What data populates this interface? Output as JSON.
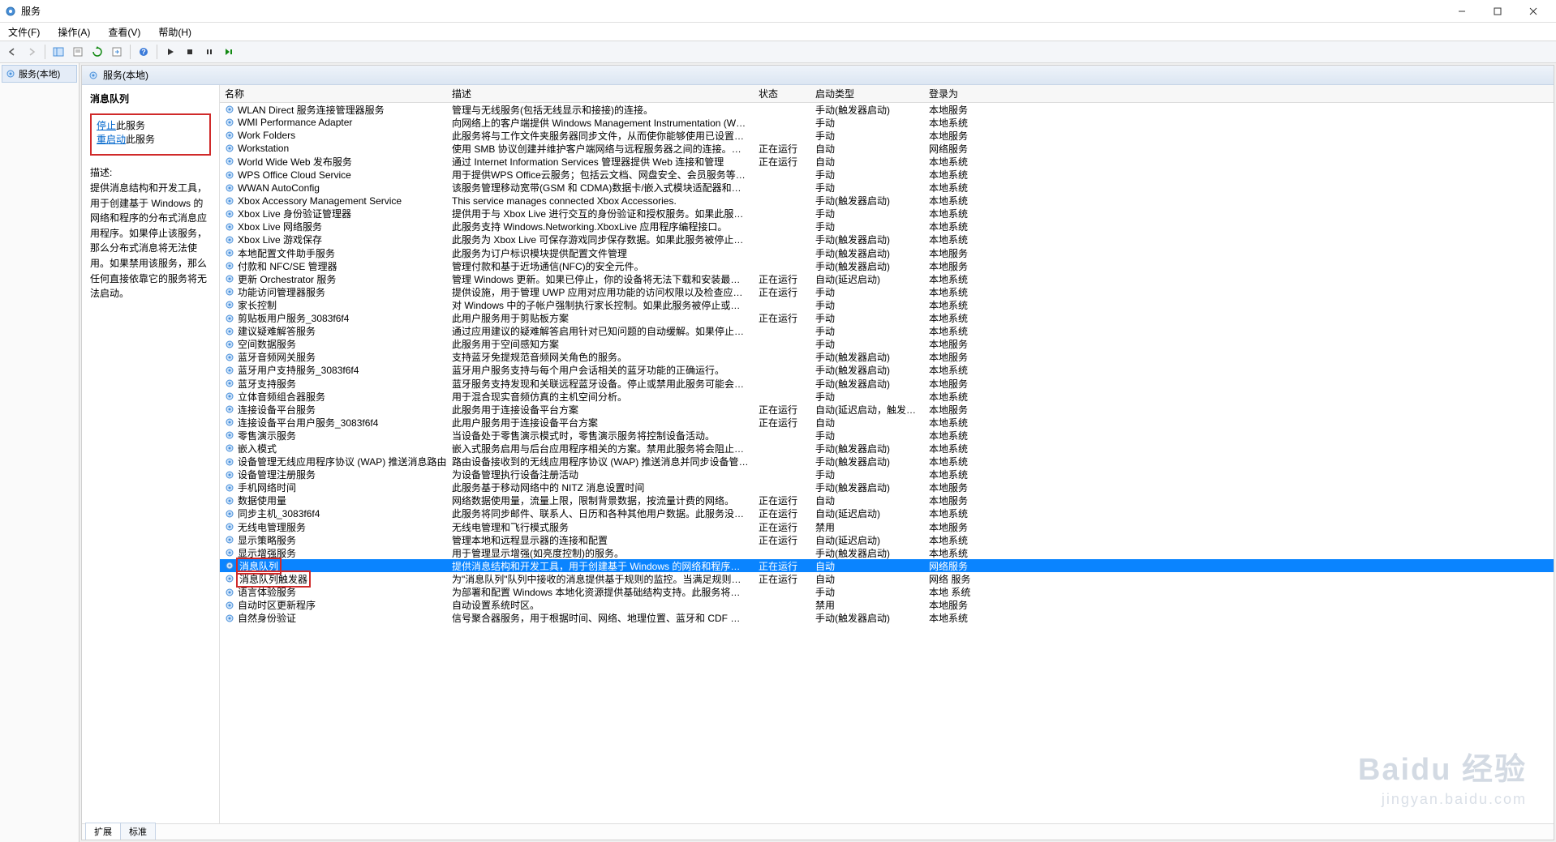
{
  "window": {
    "title": "服务"
  },
  "menu": {
    "file": "文件(F)",
    "action": "操作(A)",
    "view": "查看(V)",
    "help": "帮助(H)"
  },
  "tree": {
    "root": "服务(本地)"
  },
  "center_header": "服务(本地)",
  "detail": {
    "title": "消息队列",
    "stop_link": "停止",
    "stop_suffix": "此服务",
    "restart_link": "重启动",
    "restart_suffix": "此服务",
    "desc_label": "描述:",
    "desc_text": "提供消息结构和开发工具，用于创建基于 Windows 的网络和程序的分布式消息应用程序。如果停止该服务，那么分布式消息将无法使用。如果禁用该服务，那么任何直接依靠它的服务将无法启动。"
  },
  "columns": {
    "name": "名称",
    "desc": "描述",
    "status": "状态",
    "startup": "启动类型",
    "logon": "登录为"
  },
  "footer_tabs": {
    "extended": "扩展",
    "standard": "标准"
  },
  "watermark": {
    "brand": "Baidu 经验",
    "sub": "jingyan.baidu.com"
  },
  "services": [
    {
      "name": "WLAN Direct 服务连接管理器服务",
      "desc": "管理与无线服务(包括无线显示和接接)的连接。",
      "status": "",
      "startup": "手动(触发器启动)",
      "logon": "本地服务"
    },
    {
      "name": "WMI Performance Adapter",
      "desc": "向网络上的客户端提供 Windows Management Instrumentation (WMI) 提供程序中...",
      "status": "",
      "startup": "手动",
      "logon": "本地系统"
    },
    {
      "name": "Work Folders",
      "desc": "此服务将与工作文件夹服务器同步文件，从而使你能够使用已设置工作文件夹的任何电...",
      "status": "",
      "startup": "手动",
      "logon": "本地服务"
    },
    {
      "name": "Workstation",
      "desc": "使用 SMB 协议创建并维护客户端网络与远程服务器之间的连接。如果此服务已停止,...",
      "status": "正在运行",
      "startup": "自动",
      "logon": "网络服务"
    },
    {
      "name": "World Wide Web 发布服务",
      "desc": "通过 Internet Information Services 管理器提供 Web 连接和管理",
      "status": "正在运行",
      "startup": "自动",
      "logon": "本地系统"
    },
    {
      "name": "WPS Office Cloud Service",
      "desc": "用于提供WPS Office云服务；包括云文档、网盘安全、会员服务等多种云资源。为用户...",
      "status": "",
      "startup": "手动",
      "logon": "本地系统"
    },
    {
      "name": "WWAN AutoConfig",
      "desc": "该服务管理移动宽带(GSM 和 CDMA)数据卡/嵌入式模块适配器和自动配置网络的连接...",
      "status": "",
      "startup": "手动",
      "logon": "本地系统"
    },
    {
      "name": "Xbox Accessory Management Service",
      "desc": "This service manages connected Xbox Accessories.",
      "status": "",
      "startup": "手动(触发器启动)",
      "logon": "本地系统"
    },
    {
      "name": "Xbox Live 身份验证管理器",
      "desc": "提供用于与 Xbox Live 进行交互的身份验证和授权服务。如果此服务被停止，可能会造...",
      "status": "",
      "startup": "手动",
      "logon": "本地系统"
    },
    {
      "name": "Xbox Live 网络服务",
      "desc": "此服务支持 Windows.Networking.XboxLive 应用程序编程接口。",
      "status": "",
      "startup": "手动",
      "logon": "本地系统"
    },
    {
      "name": "Xbox Live 游戏保存",
      "desc": "此服务为 Xbox Live 可保存游戏同步保存数据。如果此服务被停止，游戏保存数据将不...",
      "status": "",
      "startup": "手动(触发器启动)",
      "logon": "本地系统"
    },
    {
      "name": "本地配置文件助手服务",
      "desc": "此服务为订户标识模块提供配置文件管理",
      "status": "",
      "startup": "手动(触发器启动)",
      "logon": "本地服务"
    },
    {
      "name": "付款和 NFC/SE 管理器",
      "desc": "管理付款和基于近场通信(NFC)的安全元件。",
      "status": "",
      "startup": "手动(触发器启动)",
      "logon": "本地服务"
    },
    {
      "name": "更新 Orchestrator 服务",
      "desc": "管理 Windows 更新。如果已停止，你的设备将无法下载和安装最新更新。",
      "status": "正在运行",
      "startup": "自动(延迟启动)",
      "logon": "本地系统"
    },
    {
      "name": "功能访问管理器服务",
      "desc": "提供设施，用于管理 UWP 应用对应用功能的访问权限以及检查应用的特定应用功能访...",
      "status": "正在运行",
      "startup": "手动",
      "logon": "本地系统"
    },
    {
      "name": "家长控制",
      "desc": "对 Windows 中的子帐户强制执行家长控制。如果此服务被停止或禁用，家长控制可能...",
      "status": "",
      "startup": "手动",
      "logon": "本地系统"
    },
    {
      "name": "剪贴板用户服务_3083f6f4",
      "desc": "此用户服务用于剪贴板方案",
      "status": "正在运行",
      "startup": "手动",
      "logon": "本地系统"
    },
    {
      "name": "建议疑难解答服务",
      "desc": "通过应用建议的疑难解答启用针对已知问题的自动缓解。如果停止，你的设备将不会获得...",
      "status": "",
      "startup": "手动",
      "logon": "本地系统"
    },
    {
      "name": "空间数据服务",
      "desc": "此服务用于空间感知方案",
      "status": "",
      "startup": "手动",
      "logon": "本地服务"
    },
    {
      "name": "蓝牙音频网关服务",
      "desc": "支持蓝牙免提规范音频网关角色的服务。",
      "status": "",
      "startup": "手动(触发器启动)",
      "logon": "本地服务"
    },
    {
      "name": "蓝牙用户支持服务_3083f6f4",
      "desc": "蓝牙用户服务支持与每个用户会话相关的蓝牙功能的正确运行。",
      "status": "",
      "startup": "手动(触发器启动)",
      "logon": "本地系统"
    },
    {
      "name": "蓝牙支持服务",
      "desc": "蓝牙服务支持发现和关联远程蓝牙设备。停止或禁用此服务可能会导致已安装的蓝牙设...",
      "status": "",
      "startup": "手动(触发器启动)",
      "logon": "本地服务"
    },
    {
      "name": "立体音频组合器服务",
      "desc": "用于混合现实音频仿真的主机空间分析。",
      "status": "",
      "startup": "手动",
      "logon": "本地系统"
    },
    {
      "name": "连接设备平台服务",
      "desc": "此服务用于连接设备平台方案",
      "status": "正在运行",
      "startup": "自动(延迟启动，触发器启动)",
      "logon": "本地服务"
    },
    {
      "name": "连接设备平台用户服务_3083f6f4",
      "desc": "此用户服务用于连接设备平台方案",
      "status": "正在运行",
      "startup": "自动",
      "logon": "本地系统"
    },
    {
      "name": "零售演示服务",
      "desc": "当设备处于零售演示模式时，零售演示服务将控制设备活动。",
      "status": "",
      "startup": "手动",
      "logon": "本地系统"
    },
    {
      "name": "嵌入模式",
      "desc": "嵌入式服务启用与后台应用程序相关的方案。禁用此服务将会阻止激活后台应用程序。",
      "status": "",
      "startup": "手动(触发器启动)",
      "logon": "本地系统"
    },
    {
      "name": "设备管理无线应用程序协议 (WAP) 推送消息路由服务",
      "desc": "路由设备接收到的无线应用程序协议 (WAP) 推送消息并同步设备管理会话",
      "status": "",
      "startup": "手动(触发器启动)",
      "logon": "本地系统"
    },
    {
      "name": "设备管理注册服务",
      "desc": "为设备管理执行设备注册活动",
      "status": "",
      "startup": "手动",
      "logon": "本地系统"
    },
    {
      "name": "手机网络时间",
      "desc": "此服务基于移动网络中的 NITZ 消息设置时间",
      "status": "",
      "startup": "手动(触发器启动)",
      "logon": "本地服务"
    },
    {
      "name": "数据使用量",
      "desc": "网络数据使用量，流量上限，限制背景数据，按流量计费的网络。",
      "status": "正在运行",
      "startup": "自动",
      "logon": "本地服务"
    },
    {
      "name": "同步主机_3083f6f4",
      "desc": "此服务将同步邮件、联系人、日历和各种其他用户数据。此服务没有运行时，依赖于此...",
      "status": "正在运行",
      "startup": "自动(延迟启动)",
      "logon": "本地系统"
    },
    {
      "name": "无线电管理服务",
      "desc": "无线电管理和飞行模式服务",
      "status": "正在运行",
      "startup": "禁用",
      "logon": "本地服务"
    },
    {
      "name": "显示策略服务",
      "desc": "管理本地和远程显示器的连接和配置",
      "status": "正在运行",
      "startup": "自动(延迟启动)",
      "logon": "本地系统"
    },
    {
      "name": "显示增强服务",
      "desc": "用于管理显示增强(如亮度控制)的服务。",
      "status": "",
      "startup": "手动(触发器启动)",
      "logon": "本地系统"
    },
    {
      "name": "消息队列",
      "desc": "提供消息结构和开发工具，用于创建基于 Windows 的网络和程序的分布式消息应用程...",
      "status": "正在运行",
      "startup": "自动",
      "logon": "网络服务",
      "selected": true,
      "boxed": true
    },
    {
      "name": "消息队列触发器",
      "desc": "为\"消息队列\"队列中接收的消息提供基于规则的监控。当满足规则条件时，调用 COM ...",
      "status": "正在运行",
      "startup": "自动",
      "logon": "网络 服务",
      "boxed": true
    },
    {
      "name": "语言体验服务",
      "desc": "为部署和配置 Windows 本地化资源提供基础结构支持。此服务将按需启动，如果禁用的...",
      "status": "",
      "startup": "手动",
      "logon": "本地 系统"
    },
    {
      "name": "自动时区更新程序",
      "desc": "自动设置系统时区。",
      "status": "",
      "startup": "禁用",
      "logon": "本地服务"
    },
    {
      "name": "自然身份验证",
      "desc": "信号聚合器服务，用于根据时间、网络、地理位置、蓝牙和 CDF 因素评估信号。支持的...",
      "status": "",
      "startup": "手动(触发器启动)",
      "logon": "本地系统"
    }
  ]
}
